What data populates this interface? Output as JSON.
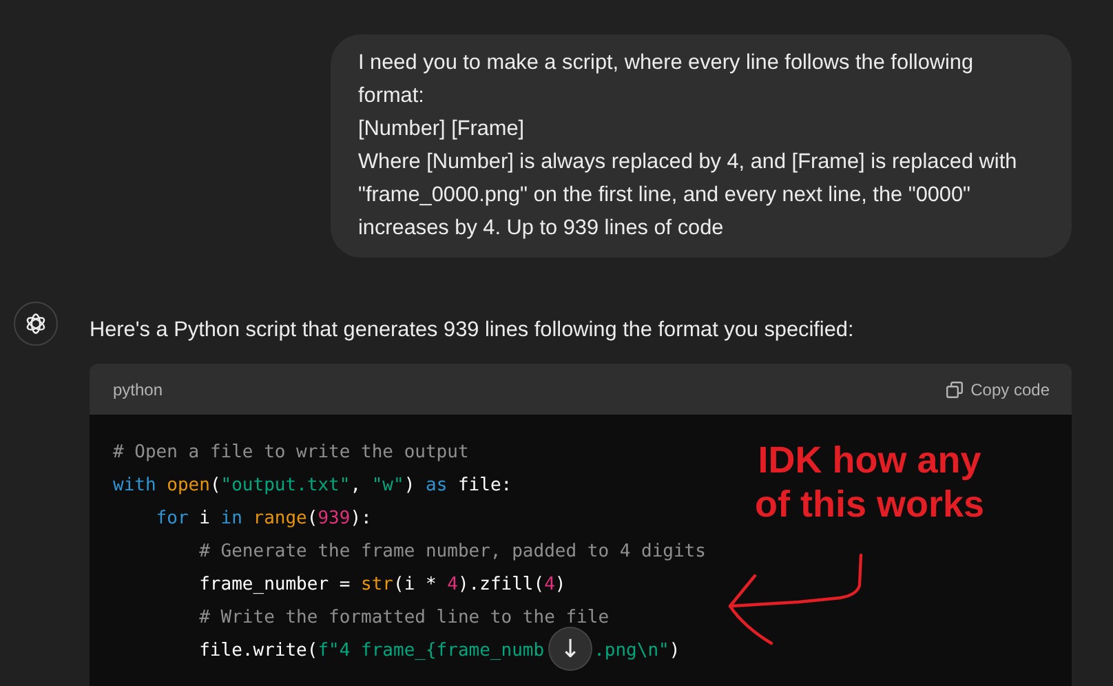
{
  "user_message": {
    "lines": [
      "I need you to make a script, where every line follows the following format:",
      "[Number] [Frame]",
      "Where [Number] is always replaced by 4, and [Frame] is replaced with \"frame_0000.png\" on the first line, and every next line, the \"0000\" increases by 4. Up to 939 lines of code"
    ]
  },
  "assistant_message": {
    "text": "Here's a Python script that generates 939 lines following the format you specified:",
    "code_block": {
      "language": "python",
      "copy_label": "Copy code",
      "lines": [
        {
          "tokens": [
            {
              "text": "# Open a file to write the output",
              "kind": "comment"
            }
          ]
        },
        {
          "tokens": [
            {
              "text": "with ",
              "kind": "keyword"
            },
            {
              "text": "open",
              "kind": "builtin"
            },
            {
              "text": "(",
              "kind": "plain"
            },
            {
              "text": "\"output.txt\"",
              "kind": "string"
            },
            {
              "text": ", ",
              "kind": "plain"
            },
            {
              "text": "\"w\"",
              "kind": "string"
            },
            {
              "text": ") ",
              "kind": "plain"
            },
            {
              "text": "as",
              "kind": "keyword"
            },
            {
              "text": " file:",
              "kind": "plain"
            }
          ],
          "children": [
            {
              "tokens": [
                {
                  "text": "for",
                  "kind": "keyword"
                },
                {
                  "text": " i ",
                  "kind": "plain"
                },
                {
                  "text": "in ",
                  "kind": "keyword"
                },
                {
                  "text": "range",
                  "kind": "builtin"
                },
                {
                  "text": "(",
                  "kind": "plain"
                },
                {
                  "text": "939",
                  "kind": "number"
                },
                {
                  "text": "):",
                  "kind": "plain"
                }
              ],
              "children": [
                {
                  "tokens": [
                    {
                      "text": "# Generate the frame number, padded to 4 digits",
                      "kind": "comment"
                    }
                  ]
                },
                {
                  "tokens": [
                    {
                      "text": "frame_number = ",
                      "kind": "plain"
                    },
                    {
                      "text": "str",
                      "kind": "builtin"
                    },
                    {
                      "text": "(i * ",
                      "kind": "plain"
                    },
                    {
                      "text": "4",
                      "kind": "number"
                    },
                    {
                      "text": ").zfill(",
                      "kind": "plain"
                    },
                    {
                      "text": "4",
                      "kind": "number"
                    },
                    {
                      "text": ")",
                      "kind": "plain"
                    }
                  ]
                },
                {
                  "tokens": [
                    {
                      "text": "# Write the formatted line to the file",
                      "kind": "comment"
                    }
                  ]
                },
                {
                  "tokens": [
                    {
                      "text": "file.write(",
                      "kind": "plain"
                    },
                    {
                      "text": "f\"4 frame_{frame_numb",
                      "kind": "string"
                    },
                    {
                      "text": ".png\\n\"",
                      "kind": "string",
                      "after_gap": true
                    },
                    {
                      "text": ")",
                      "kind": "plain"
                    }
                  ]
                }
              ]
            }
          ]
        }
      ]
    }
  },
  "scroll_button": {
    "label": "↓"
  },
  "annotation": {
    "text_lines": [
      "IDK how any",
      "of this works"
    ]
  }
}
